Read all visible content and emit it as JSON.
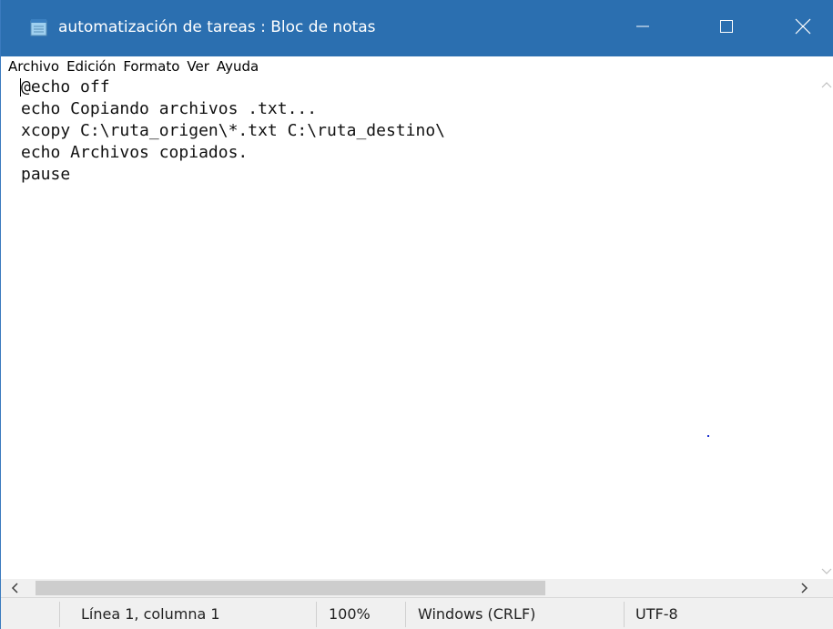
{
  "window": {
    "title": "automatización de tareas : Bloc de notas",
    "icon": "notepad-icon",
    "controls": {
      "minimize": "minimize-icon",
      "maximize": "maximize-icon",
      "close": "close-icon"
    }
  },
  "menu": {
    "items": [
      "Archivo",
      "Edición",
      "Formato",
      "Ver",
      "Ayuda"
    ]
  },
  "editor": {
    "lines": [
      "@echo off",
      "echo Copiando archivos .txt...",
      "xcopy C:\\ruta_origen\\*.txt C:\\ruta_destino\\",
      "echo Archivos copiados.",
      "pause"
    ]
  },
  "status": {
    "position": "Línea 1, columna 1",
    "zoom": "100%",
    "line_ending": "Windows (CRLF)",
    "encoding": "UTF-8"
  },
  "colors": {
    "titlebar": "#2b6fb0",
    "text": "#111111",
    "statusbar": "#f0f0f0"
  }
}
